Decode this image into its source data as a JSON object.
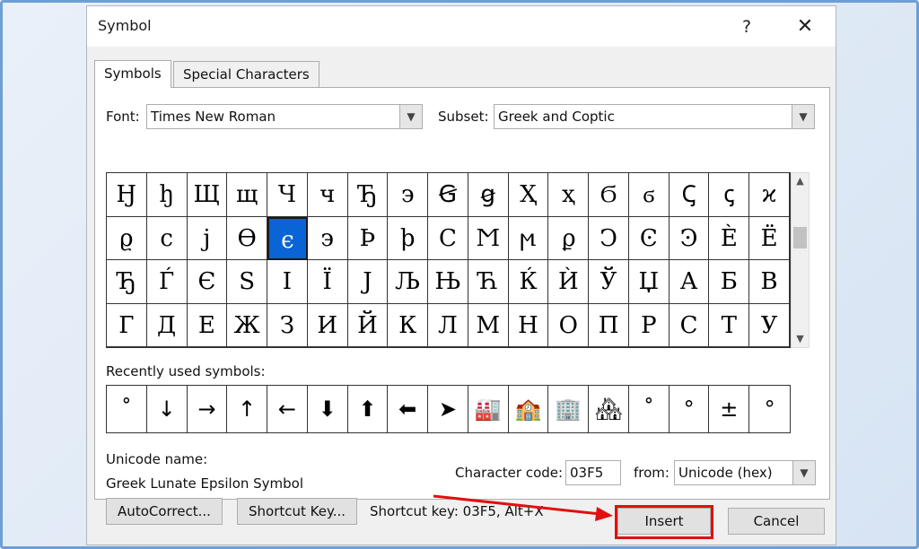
{
  "dialog": {
    "title": "Symbol",
    "help": "?",
    "close": "✕"
  },
  "tabs": [
    {
      "label": "Symbols",
      "active": true
    },
    {
      "label": "Special Characters",
      "active": false
    }
  ],
  "font": {
    "label": "Font:",
    "value": "Times New Roman"
  },
  "subset": {
    "label": "Subset:",
    "value": "Greek and Coptic"
  },
  "symbols": [
    [
      "Ꜧ",
      "ꜧ",
      "Щ",
      "щ",
      "Ч",
      "ч",
      "Ђ",
      "э",
      "Ꞡ",
      "ꞡ",
      "Ҳ",
      "ҳ",
      "Ϭ",
      "ϭ",
      "Ꞔ",
      "ꞔ",
      "ϰ"
    ],
    [
      "ϱ",
      "ϲ",
      "ϳ",
      "ϴ",
      "ϵ",
      "϶",
      "Ϸ",
      "ϸ",
      "Ϲ",
      "Ϻ",
      "ϻ",
      "ϼ",
      "Ͻ",
      "Ͼ",
      "Ͽ",
      "Ѐ",
      "Ё"
    ],
    [
      "Ђ",
      "Ѓ",
      "Є",
      "Ѕ",
      "І",
      "Ї",
      "Ј",
      "Љ",
      "Њ",
      "Ћ",
      "Ќ",
      "Ѝ",
      "Ў",
      "Џ",
      "А",
      "Б",
      "В"
    ],
    [
      "Г",
      "Д",
      "Е",
      "Ж",
      "З",
      "И",
      "Й",
      "К",
      "Л",
      "М",
      "Н",
      "О",
      "П",
      "Р",
      "С",
      "Т",
      "У"
    ]
  ],
  "selected_symbol": {
    "row": 1,
    "col": 4
  },
  "recent": {
    "label": "Recently used symbols:",
    "items": [
      "˚",
      "↓",
      "→",
      "↑",
      "←",
      "⬇",
      "⬆",
      "⬅",
      "➤",
      "🏭",
      "🏫",
      "🏢",
      "🏘",
      "˚",
      "°",
      "±",
      "°"
    ]
  },
  "unicode": {
    "name_label": "Unicode name:",
    "name_value": "Greek Lunate Epsilon Symbol",
    "code_label": "Character code:",
    "code_value": "03F5",
    "from_label": "from:",
    "from_value": "Unicode (hex)"
  },
  "buttons": {
    "autocorrect": "AutoCorrect...",
    "shortcut_key": "Shortcut Key...",
    "shortcut_text": "Shortcut key: 03F5, Alt+X",
    "insert": "Insert",
    "cancel": "Cancel"
  },
  "colors": {
    "selection": "#0a64d6",
    "highlight_box": "#e01010",
    "frame": "#6d9fd6"
  }
}
